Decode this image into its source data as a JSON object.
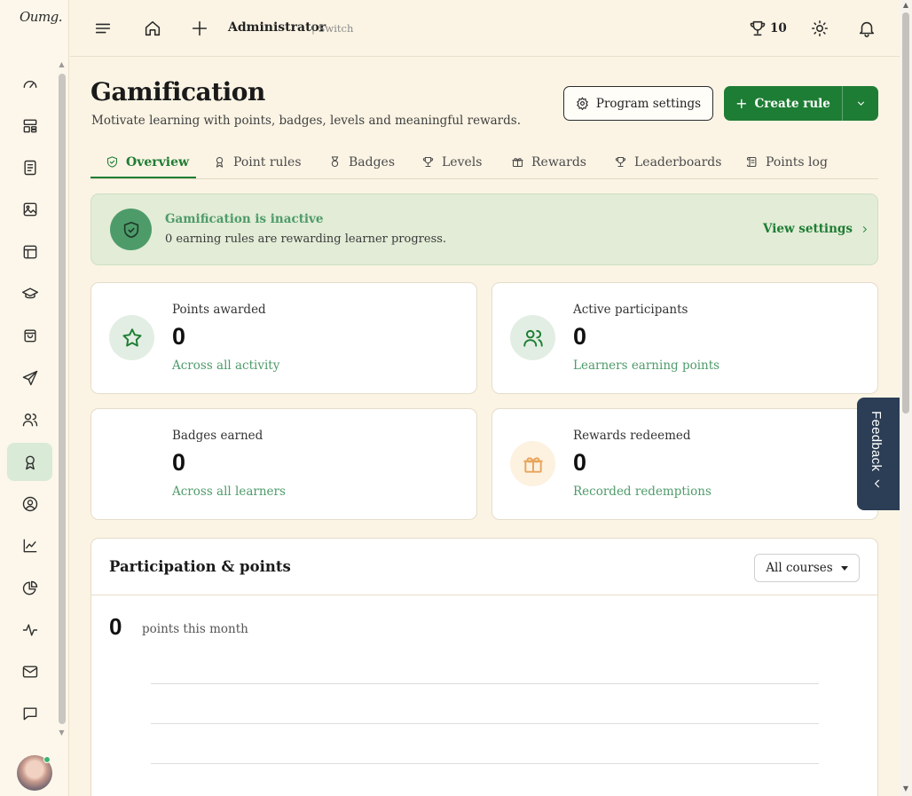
{
  "app": {
    "logo_text": "Oumg.",
    "user": {
      "name": "Administrator",
      "switch_label": "| Switch"
    },
    "trophy_count": "10",
    "feedback_label": "Feedback"
  },
  "page": {
    "title": "Gamification",
    "subtitle": "Motivate learning with points, badges, levels and meaningful rewards.",
    "buttons": {
      "program_settings": "Program settings",
      "create_rule": "Create rule"
    }
  },
  "tabs": [
    {
      "label": "Overview",
      "icon": "shield-check-icon",
      "active": true
    },
    {
      "label": "Point rules",
      "icon": "award-icon",
      "active": false
    },
    {
      "label": "Badges",
      "icon": "medal-icon",
      "active": false
    },
    {
      "label": "Levels",
      "icon": "trophy-icon",
      "active": false
    },
    {
      "label": "Rewards",
      "icon": "gift-icon",
      "active": false
    },
    {
      "label": "Leaderboards",
      "icon": "trophy-icon",
      "active": false
    },
    {
      "label": "Points log",
      "icon": "scroll-icon",
      "active": false
    }
  ],
  "banner": {
    "title": "Gamification is inactive",
    "description": "0 earning rules are rewarding learner progress.",
    "link": "View settings"
  },
  "stats": [
    {
      "label": "Points awarded",
      "value": "0",
      "sub": "Across all activity",
      "icon": "star-icon"
    },
    {
      "label": "Active participants",
      "value": "0",
      "sub": "Learners earning points",
      "icon": "users-icon"
    },
    {
      "label": "Badges earned",
      "value": "0",
      "sub": "Across all learners",
      "icon": "badge-icon"
    },
    {
      "label": "Rewards redeemed",
      "value": "0",
      "sub": "Recorded redemptions",
      "icon": "gift-icon"
    }
  ],
  "participation": {
    "title": "Participation & points",
    "filter": "All courses",
    "month_value": "0",
    "month_label": "points this month"
  },
  "colors": {
    "brand_green": "#1e7d34",
    "accent_green": "#4e9b6a",
    "background": "#fbf4e4",
    "feedback_bg": "#2c3e55",
    "reward_icon": "#e8a55a"
  },
  "sidebar_icons": [
    "dashboard-gauge-icon",
    "layout-grid-icon",
    "document-list-icon",
    "image-icon",
    "template-icon",
    "graduation-cap-icon",
    "shopping-bag-icon",
    "send-icon",
    "users-icon",
    "award-icon",
    "user-circle-icon",
    "line-chart-icon",
    "pie-chart-icon",
    "activity-icon",
    "mail-icon",
    "chat-icon"
  ]
}
